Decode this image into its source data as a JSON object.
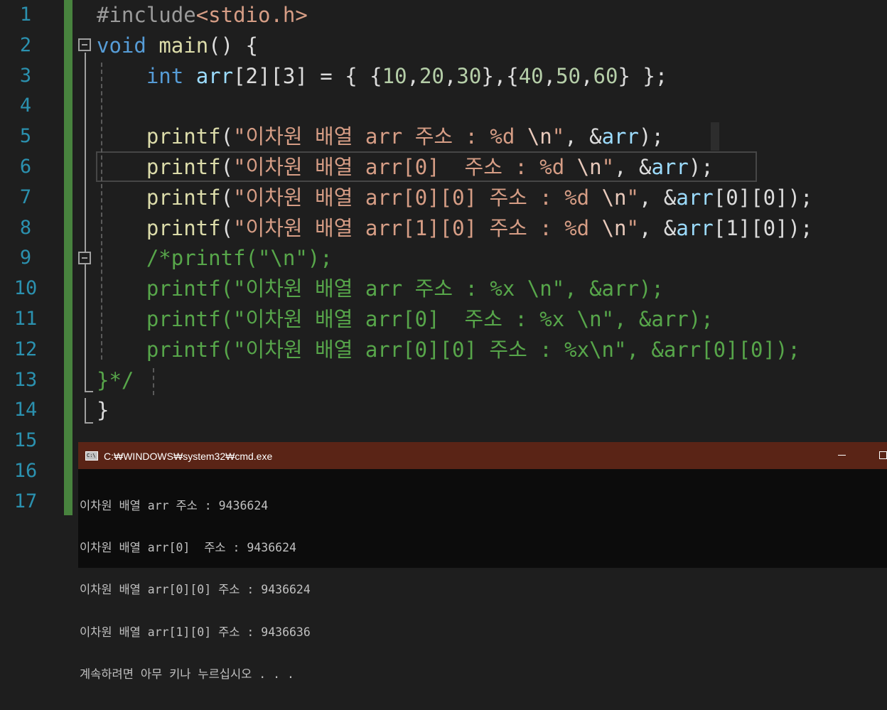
{
  "editor": {
    "line_numbers": [
      "1",
      "2",
      "3",
      "4",
      "5",
      "6",
      "7",
      "8",
      "9",
      "10",
      "11",
      "12",
      "13",
      "14",
      "15",
      "16",
      "17"
    ],
    "lines": [
      [
        {
          "t": "#include",
          "c": "pp"
        },
        {
          "t": "<stdio.h>",
          "c": "inc"
        }
      ],
      [
        {
          "t": "void",
          "c": "kw"
        },
        {
          "t": " ",
          "c": ""
        },
        {
          "t": "main",
          "c": "fn"
        },
        {
          "t": "() {",
          "c": ""
        }
      ],
      [
        {
          "t": "    ",
          "c": ""
        },
        {
          "t": "int",
          "c": "kw"
        },
        {
          "t": " ",
          "c": ""
        },
        {
          "t": "arr",
          "c": "var"
        },
        {
          "t": "[2][3] = { {",
          "c": ""
        },
        {
          "t": "10",
          "c": "num"
        },
        {
          "t": ",",
          "c": ""
        },
        {
          "t": "20",
          "c": "num"
        },
        {
          "t": ",",
          "c": ""
        },
        {
          "t": "30",
          "c": "num"
        },
        {
          "t": "},{",
          "c": ""
        },
        {
          "t": "40",
          "c": "num"
        },
        {
          "t": ",",
          "c": ""
        },
        {
          "t": "50",
          "c": "num"
        },
        {
          "t": ",",
          "c": ""
        },
        {
          "t": "60",
          "c": "num"
        },
        {
          "t": "} };",
          "c": ""
        }
      ],
      [],
      [
        {
          "t": "    ",
          "c": ""
        },
        {
          "t": "printf",
          "c": "fn"
        },
        {
          "t": "(",
          "c": ""
        },
        {
          "t": "\"이차원 배열 arr 주소 : %d ",
          "c": "str"
        },
        {
          "t": "\\n",
          "c": "esc"
        },
        {
          "t": "\"",
          "c": "str"
        },
        {
          "t": ", &",
          "c": ""
        },
        {
          "t": "arr",
          "c": "var"
        },
        {
          "t": ");",
          "c": ""
        }
      ],
      [
        {
          "t": "    ",
          "c": ""
        },
        {
          "t": "printf",
          "c": "fn"
        },
        {
          "t": "(",
          "c": ""
        },
        {
          "t": "\"이차원 배열 arr[0]  주소 : %d ",
          "c": "str"
        },
        {
          "t": "\\n",
          "c": "esc"
        },
        {
          "t": "\"",
          "c": "str"
        },
        {
          "t": ", &",
          "c": ""
        },
        {
          "t": "arr",
          "c": "var"
        },
        {
          "t": ");",
          "c": ""
        }
      ],
      [
        {
          "t": "    ",
          "c": ""
        },
        {
          "t": "printf",
          "c": "fn"
        },
        {
          "t": "(",
          "c": ""
        },
        {
          "t": "\"이차원 배열 arr[0][0] 주소 : %d ",
          "c": "str"
        },
        {
          "t": "\\n",
          "c": "esc"
        },
        {
          "t": "\"",
          "c": "str"
        },
        {
          "t": ", &",
          "c": ""
        },
        {
          "t": "arr",
          "c": "var"
        },
        {
          "t": "[0][0]);",
          "c": ""
        }
      ],
      [
        {
          "t": "    ",
          "c": ""
        },
        {
          "t": "printf",
          "c": "fn"
        },
        {
          "t": "(",
          "c": ""
        },
        {
          "t": "\"이차원 배열 arr[1][0] 주소 : %d ",
          "c": "str"
        },
        {
          "t": "\\n",
          "c": "esc"
        },
        {
          "t": "\"",
          "c": "str"
        },
        {
          "t": ", &",
          "c": ""
        },
        {
          "t": "arr",
          "c": "var"
        },
        {
          "t": "[1][0]);",
          "c": ""
        }
      ],
      [
        {
          "t": "    /*printf(\"\\n\");",
          "c": "cm"
        }
      ],
      [
        {
          "t": "    printf(\"이차원 배열 arr 주소 : %x \\n\", &arr);",
          "c": "cm"
        }
      ],
      [
        {
          "t": "    printf(\"이차원 배열 arr[0]  주소 : %x \\n\", &arr);",
          "c": "cm"
        }
      ],
      [
        {
          "t": "    printf(\"이차원 배열 arr[0][0] 주소 : %x\\n\", &arr[0][0]);",
          "c": "cm"
        }
      ],
      [
        {
          "t": "}*/",
          "c": "cm"
        }
      ],
      [
        {
          "t": "}",
          "c": ""
        }
      ],
      [],
      [],
      []
    ]
  },
  "console": {
    "title": "C:₩WINDOWS₩system32₩cmd.exe",
    "icon": "cmd-icon",
    "minimize_label": "",
    "maximize_label": "",
    "output": [
      "이차원 배열 arr 주소 : 9436624",
      "이차원 배열 arr[0]  주소 : 9436624",
      "이차원 배열 arr[0][0] 주소 : 9436624",
      "이차원 배열 arr[1][0] 주소 : 9436636",
      "계속하려면 아무 키나 누르십시오 . . ."
    ]
  }
}
